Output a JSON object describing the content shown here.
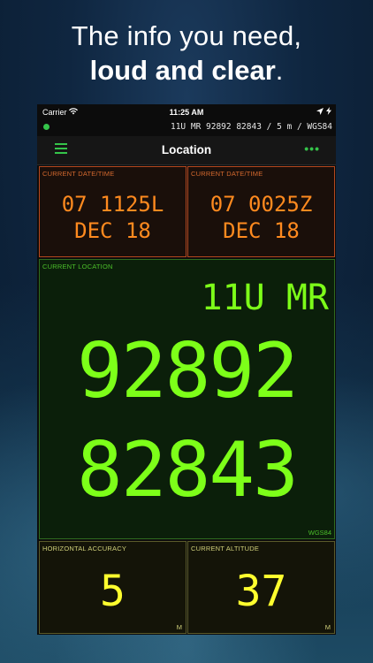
{
  "headline": {
    "line1": "The info you need,",
    "line2_bold": "loud and clear",
    "line2_tail": "."
  },
  "status_bar": {
    "carrier": "Carrier",
    "time": "11:25 AM",
    "icons": [
      "wifi-icon",
      "location-arrow-icon",
      "battery-charging-icon"
    ]
  },
  "info_bar": {
    "text": "11U MR 92892 82843 / 5 m / WGS84"
  },
  "nav": {
    "title": "Location",
    "more": "•••"
  },
  "panels": {
    "local_time": {
      "label": "CURRENT DATE/TIME",
      "line1": "07 1125L",
      "line2": "DEC 18"
    },
    "zulu_time": {
      "label": "CURRENT DATE/TIME",
      "line1": "07 0025Z",
      "line2": "DEC 18"
    },
    "location": {
      "label": "CURRENT LOCATION",
      "zone": "11U MR",
      "easting": "92892",
      "northing": "82843",
      "datum": "WGS84"
    },
    "accuracy": {
      "label": "HORIZONTAL ACCURACY",
      "value": "5",
      "unit": "M"
    },
    "altitude": {
      "label": "CURRENT ALTITUDE",
      "value": "37",
      "unit": "M"
    }
  },
  "colors": {
    "accent_green": "#35c44a",
    "location_green": "#7dff19",
    "time_orange": "#ff8a1f",
    "value_yellow": "#ffff2e"
  }
}
